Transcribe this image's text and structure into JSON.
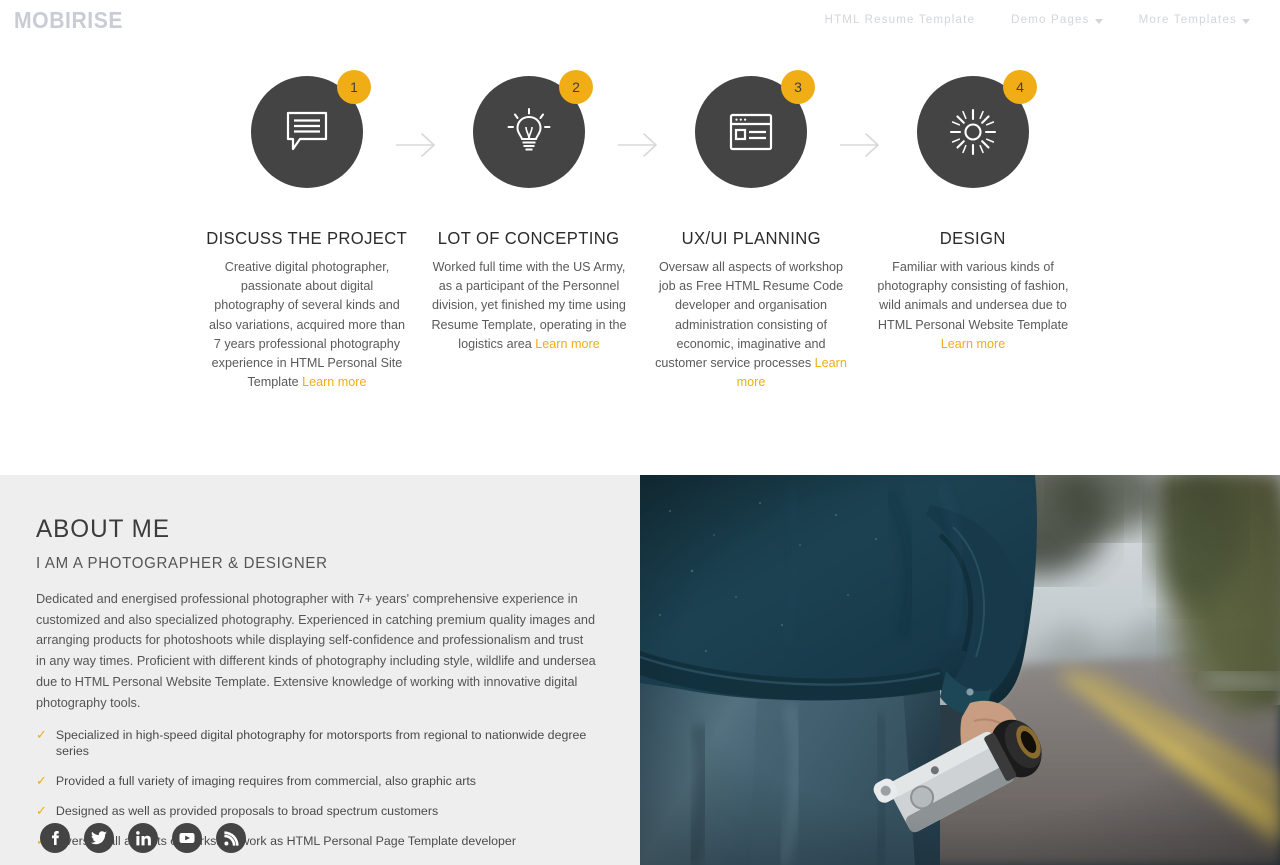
{
  "header": {
    "brand": "MOBIRISE",
    "nav": [
      {
        "label": "HTML Resume Template",
        "has_caret": false
      },
      {
        "label": "Demo Pages",
        "has_caret": true
      },
      {
        "label": "More Templates",
        "has_caret": true
      }
    ]
  },
  "process": {
    "steps": [
      {
        "number": "1",
        "icon": "speech-bubble-icon",
        "title": "DISCUSS THE PROJECT",
        "text": "Creative digital photographer, passionate about digital photography of several kinds and also variations, acquired more than 7 years professional photography experience in HTML Personal Site Template ",
        "link": "Learn more"
      },
      {
        "number": "2",
        "icon": "lightbulb-icon",
        "title": "LOT OF CONCEPTING",
        "text": "Worked full time with the US Army, as a participant of the Personnel division, yet finished my time using Resume Template, operating in the logistics area ",
        "link": "Learn more"
      },
      {
        "number": "3",
        "icon": "browser-window-icon",
        "title": "UX/UI PLANNING",
        "text": "Oversaw all aspects of workshop job as Free HTML Resume Code developer and organisation administration consisting of economic, imaginative and customer service processes ",
        "link": "Learn more"
      },
      {
        "number": "4",
        "icon": "sun-icon",
        "title": "DESIGN",
        "text": "Familiar with various kinds of photography consisting of fashion, wild animals and undersea due to HTML Personal Website Template ",
        "link": "Learn more"
      }
    ],
    "separator_icon": "arrow-right-icon"
  },
  "about": {
    "title": "ABOUT ME",
    "subtitle": "I AM A PHOTOGRAPHER & DESIGNER",
    "body": "Dedicated and energised professional photographer with 7+ years' comprehensive experience in customized and also specialized photography. Experienced in catching premium quality images and arranging products for photoshoots while displaying self-confidence and professionalism and trust in any way times. Proficient with different kinds of photography including style, wildlife and undersea due to HTML Personal Website Template. Extensive knowledge of working with innovative digital photography tools.",
    "check_symbol": "✓",
    "checklist": [
      "Specialized in high-speed digital photography for motorsports from regional to nationwide degree series",
      "Provided a full variety of imaging requires from commercial, also graphic arts",
      "Designed as well as provided proposals to broad spectrum customers",
      "Oversaw all aspects of workshop work as HTML Personal Page Template developer"
    ],
    "social": [
      {
        "name": "facebook-icon",
        "label": "f"
      },
      {
        "name": "twitter-icon",
        "label": "t"
      },
      {
        "name": "linkedin-icon",
        "label": "in"
      },
      {
        "name": "youtube-icon",
        "label": "yt"
      },
      {
        "name": "rss-icon",
        "label": "rss"
      }
    ],
    "photo_alt": "Photographer walking on a road holding a film camera"
  },
  "colors": {
    "accent": "#f0ad16",
    "dark_circle": "#444444",
    "section_bg": "#eeeeee",
    "page_bg": "#ffffff",
    "nav_text": "#d2d5db",
    "body_text": "#555555"
  }
}
